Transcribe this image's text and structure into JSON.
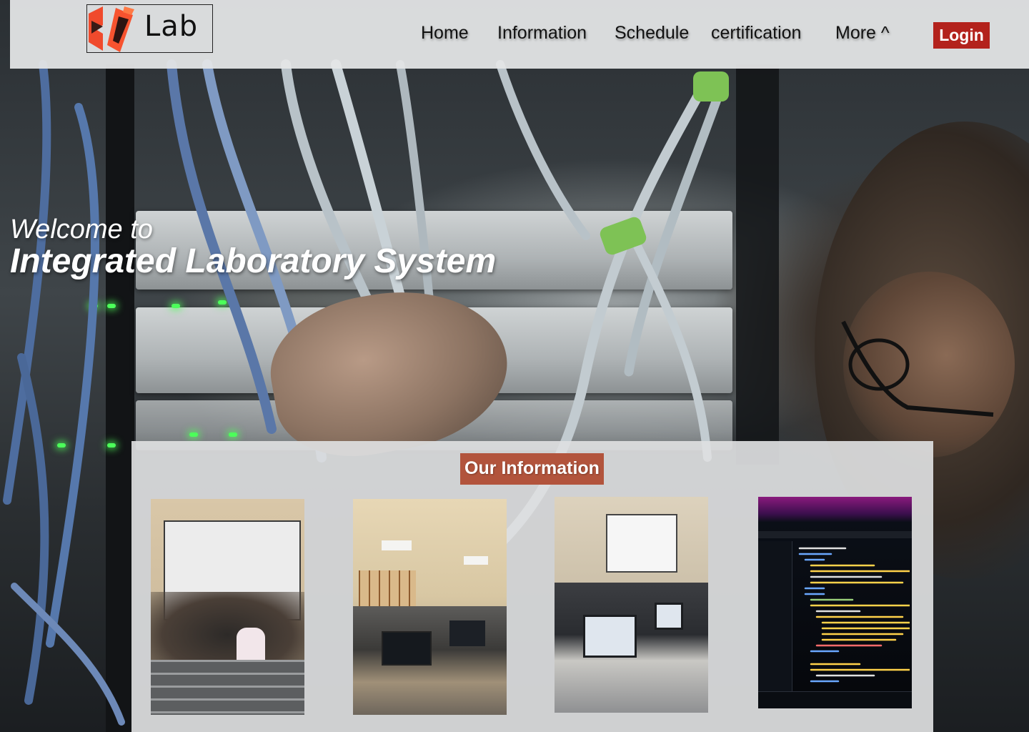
{
  "brand": {
    "logo_text": "Lab"
  },
  "nav": {
    "items": [
      {
        "label": "Home"
      },
      {
        "label": "Information"
      },
      {
        "label": "Schedule"
      },
      {
        "label": "certification"
      },
      {
        "label": "More ^"
      }
    ],
    "login_label": "Login"
  },
  "hero": {
    "welcome": "Welcome to",
    "title": "Integrated Laboratory System"
  },
  "info": {
    "heading": "Our Information"
  },
  "colors": {
    "accent_red": "#b3221c",
    "heading_orange": "#b2543c",
    "navbar_bg": "#e4e6e7"
  }
}
